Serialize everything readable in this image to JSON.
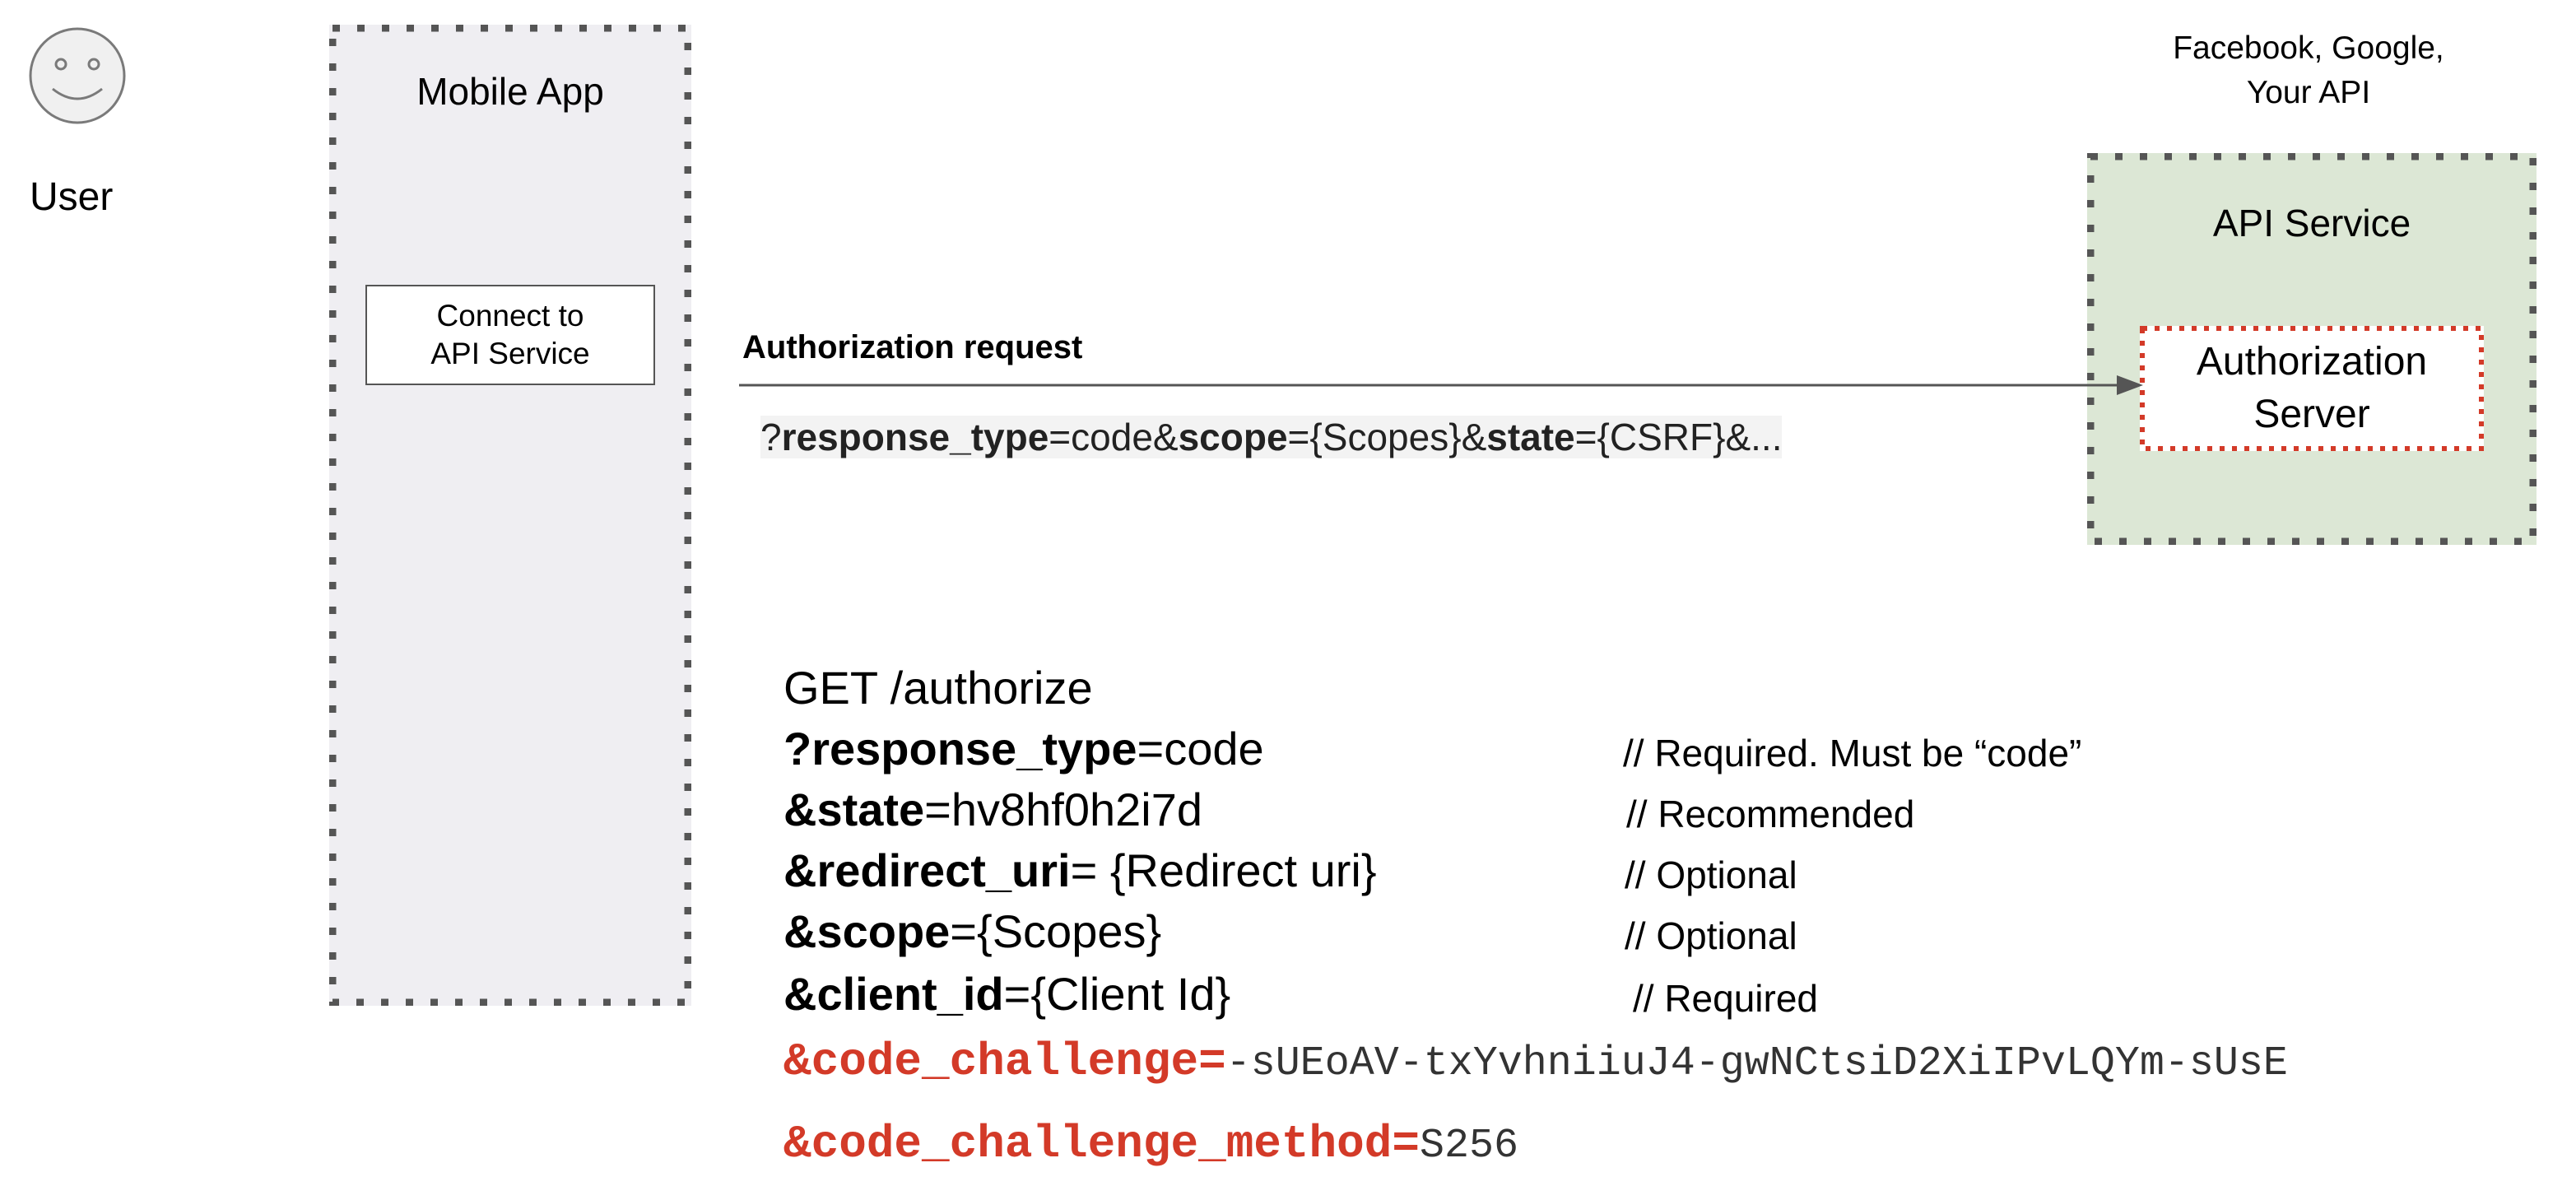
{
  "user": {
    "label": "User",
    "icon": "smiley-face-icon"
  },
  "mobile_app": {
    "title": "Mobile App",
    "connect_button_label": "Connect to\nAPI Service",
    "background": "#efeef2"
  },
  "provider_label": "Facebook, Google,\nYour API",
  "api_service": {
    "title": "API Service",
    "auth_server_label": "Authorization\nServer",
    "background": "#dce7d5",
    "auth_server_border_color": "#d33a28"
  },
  "auth_request": {
    "label": "Authorization request",
    "query": {
      "p1": "?",
      "k1": "response_type",
      "v1": "=code&",
      "k2": "scope",
      "v2": "={Scopes}&",
      "k3": "state",
      "v3": "={CSRF}&..."
    }
  },
  "request": {
    "method_line": "GET /authorize",
    "params": [
      {
        "key": "?response_type",
        "value": "=code",
        "comment": "// Required. Must be “code”"
      },
      {
        "key": "&state",
        "value": "=hv8hf0h2i7d",
        "comment": "// Recommended"
      },
      {
        "key": "&redirect_uri",
        "value": "= {Redirect uri}",
        "comment": "// Optional"
      },
      {
        "key": "&scope",
        "value": "={Scopes}",
        "comment": "// Optional"
      },
      {
        "key": "&client_id",
        "value": "={Client Id}",
        "comment": "// Required"
      }
    ],
    "pkce_params": [
      {
        "key": "&code_challenge=",
        "value": "-sUEoAV-txYvhniiuJ4-gwNCtsiD2XiIPvLQYm-sUsE"
      },
      {
        "key": "&code_challenge_method=",
        "value": "S256"
      }
    ],
    "highlight_color": "#d33a28"
  }
}
